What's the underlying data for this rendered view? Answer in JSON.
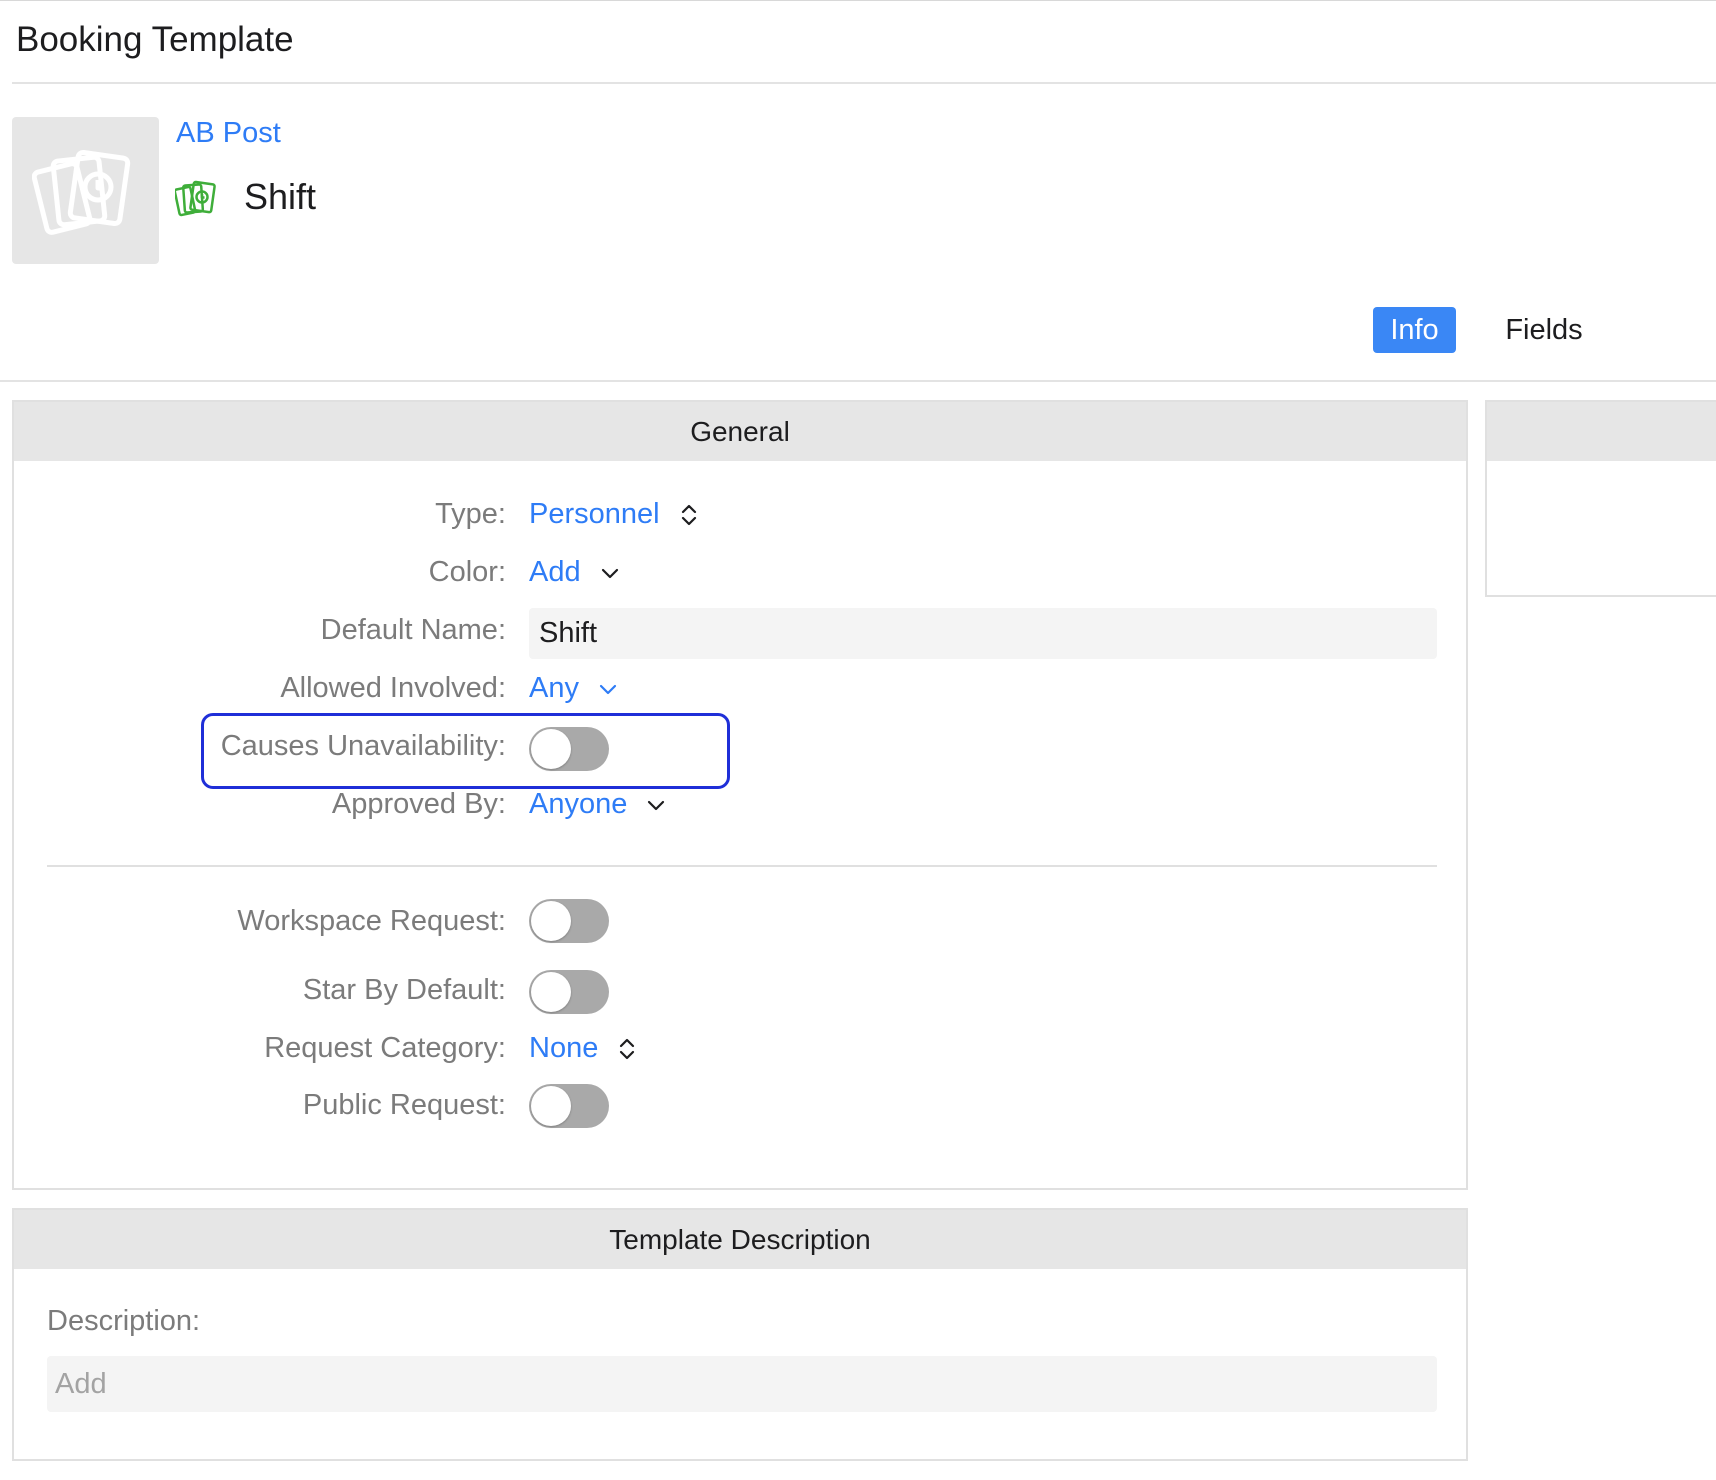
{
  "header": {
    "title": "Booking Template"
  },
  "template": {
    "category_link": "AB Post",
    "name": "Shift",
    "thumbnail_icon": "cards-clock-icon",
    "name_icon": "cards-clock-icon",
    "name_icon_color": "#3fae3a"
  },
  "tabs": [
    {
      "label": "Info",
      "active": true
    },
    {
      "label": "Fields",
      "active": false
    }
  ],
  "general": {
    "title": "General",
    "type": {
      "label": "Type:",
      "value": "Personnel"
    },
    "color": {
      "label": "Color:",
      "value": "Add"
    },
    "default_name": {
      "label": "Default Name:",
      "value": "Shift"
    },
    "allowed_involved": {
      "label": "Allowed Involved:",
      "value": "Any"
    },
    "causes_unavailability": {
      "label": "Causes Unavailability:",
      "on": false
    },
    "approved_by": {
      "label": "Approved By:",
      "value": "Anyone"
    },
    "workspace_request": {
      "label": "Workspace Request:",
      "on": false
    },
    "star_by_default": {
      "label": "Star By Default:",
      "on": false
    },
    "request_category": {
      "label": "Request Category:",
      "value": "None"
    },
    "public_request": {
      "label": "Public Request:",
      "on": false
    }
  },
  "description_panel": {
    "title": "Template Description",
    "label": "Description:",
    "placeholder": "Add"
  },
  "colors": {
    "accent": "#2e7cf6",
    "active_tab": "#3a87f5",
    "highlight_border": "#1f2fd8",
    "toggle_off": "#a9a9a9"
  }
}
